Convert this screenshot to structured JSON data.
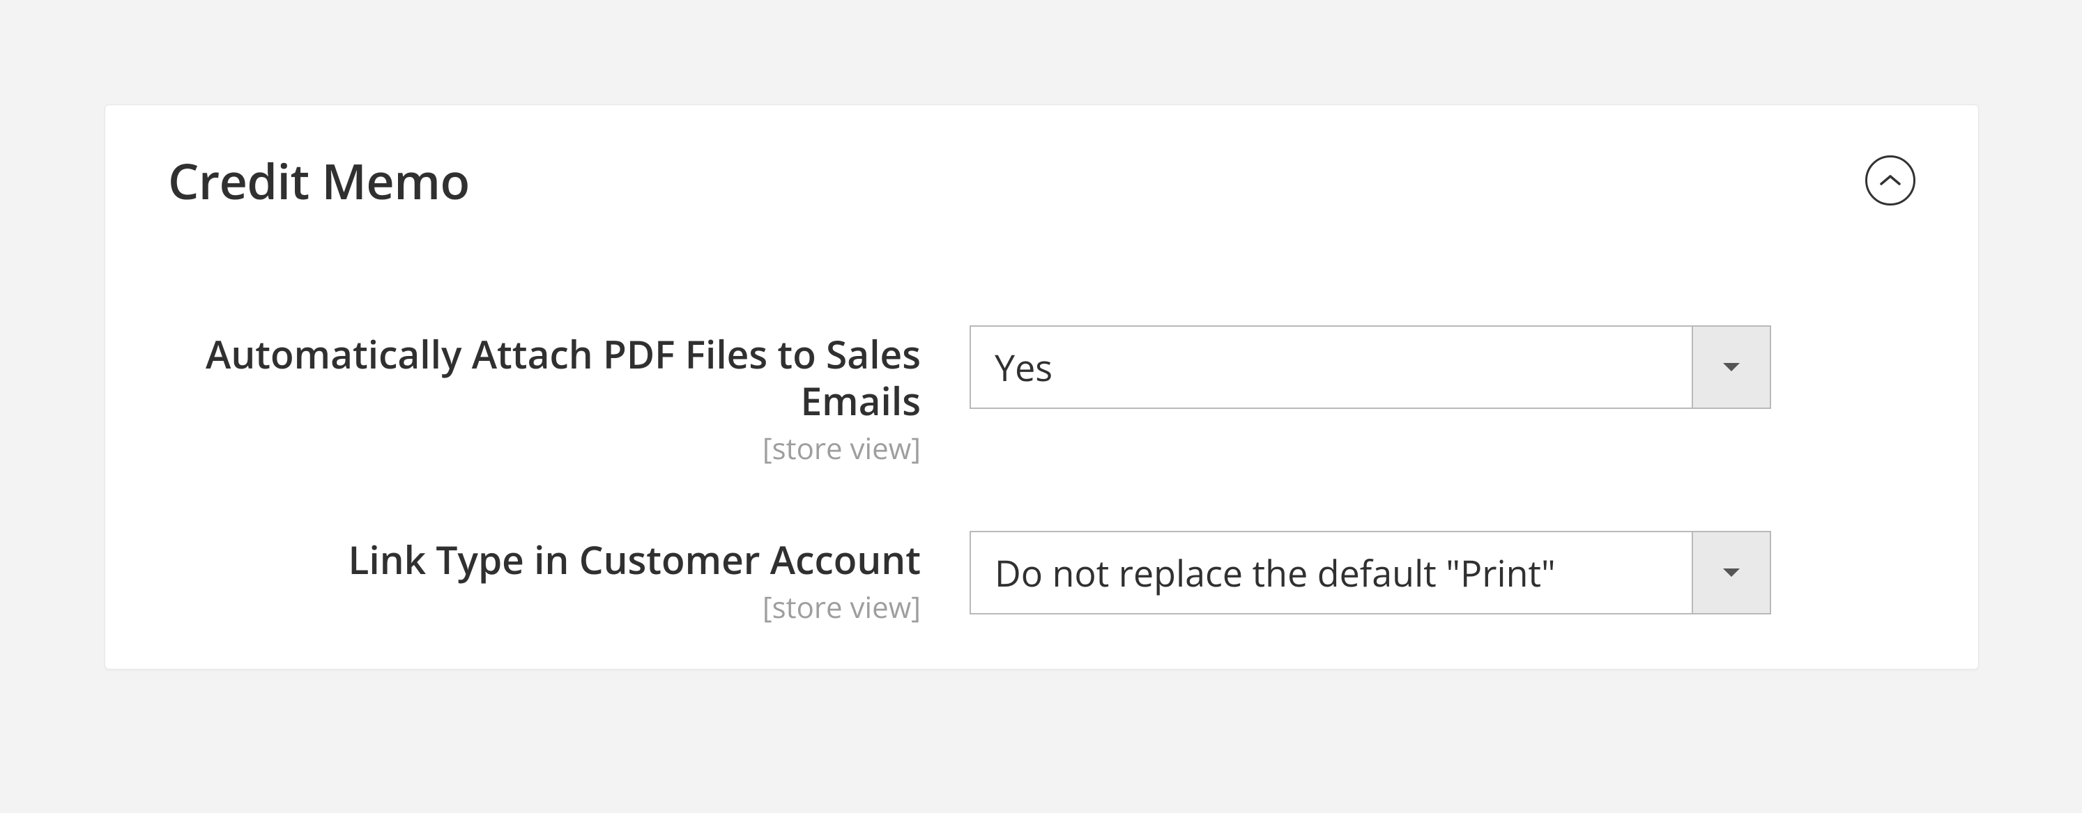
{
  "section": {
    "title": "Credit Memo",
    "collapse_icon": "chevron-up"
  },
  "fields": {
    "auto_attach_pdf": {
      "label": "Automatically Attach PDF Files to Sales Emails",
      "scope": "[store view]",
      "value": "Yes"
    },
    "link_type": {
      "label": "Link Type in Customer Account",
      "scope": "[store view]",
      "value": "Do not replace the default \"Print\" "
    }
  }
}
